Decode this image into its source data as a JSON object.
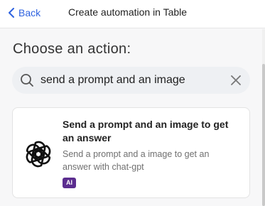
{
  "header": {
    "back_label": "Back",
    "title": "Create automation in Table"
  },
  "main": {
    "section_title": "Choose an action:",
    "search": {
      "value": "send a prompt and an image",
      "placeholder": ""
    },
    "results": [
      {
        "title": "Send a prompt and an image to get an answer",
        "description": "Send a prompt and a image to get an answer with chat-gpt",
        "badge": "AI",
        "icon": "openai-logo-icon"
      }
    ]
  },
  "colors": {
    "accent": "#2f63e0",
    "badge": "#5b2d8f"
  }
}
